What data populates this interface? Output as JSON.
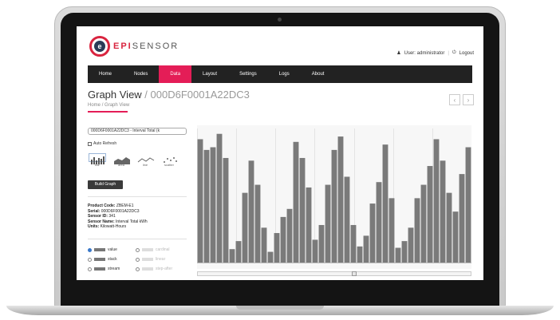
{
  "brand": {
    "name_accent": "EPI",
    "name_rest": "SENSOR",
    "mark": "e",
    "accent_color": "#e41d57"
  },
  "user": {
    "icon": "user-icon",
    "label": "User: administrator",
    "logout_icon": "power-icon",
    "logout": "Logout"
  },
  "nav": {
    "items": [
      {
        "label": "Home"
      },
      {
        "label": "Nodes"
      },
      {
        "label": "Data",
        "active": true
      },
      {
        "label": "Layout"
      },
      {
        "label": "Settings"
      },
      {
        "label": "Logs"
      },
      {
        "label": "About"
      }
    ]
  },
  "page": {
    "title": "Graph View",
    "subtitle": "000D6F0001A22DC3",
    "breadcrumb": {
      "home": "Home",
      "current": "Graph View"
    },
    "prev": "‹",
    "next": "›"
  },
  "panel": {
    "series_value": "000D6F0001A22DC3 - Interval Total (k",
    "auto_refresh": "Auto Refresh",
    "chart_types": [
      {
        "label": "bar",
        "active": true
      },
      {
        "label": "area"
      },
      {
        "label": "line"
      },
      {
        "label": "scatter"
      }
    ],
    "build_button": "Build Graph",
    "meta": [
      {
        "key": "Product Code:",
        "value": "ZBEM-E1"
      },
      {
        "key": "Serial:",
        "value": "000D6F0001A22DC3"
      },
      {
        "key": "Sensor ID:",
        "value": "341"
      },
      {
        "key": "Sensor Name:",
        "value": "Interval Total kWh"
      },
      {
        "key": "Units:",
        "value": "Kilowatt-Hours"
      }
    ],
    "modes": [
      {
        "label": "value",
        "checked": true
      },
      {
        "label": "cardinal",
        "disabled": true
      },
      {
        "label": "stack"
      },
      {
        "label": "linear",
        "disabled": true
      },
      {
        "label": "stream"
      },
      {
        "label": "step-after",
        "disabled": true
      }
    ]
  },
  "chart_data": {
    "type": "bar",
    "values": [
      92,
      84,
      86,
      96,
      78,
      10,
      16,
      52,
      76,
      58,
      26,
      8,
      22,
      34,
      40,
      90,
      78,
      56,
      17,
      28,
      58,
      84,
      94,
      64,
      28,
      12,
      20,
      44,
      60,
      88,
      48,
      11,
      16,
      26,
      48,
      58,
      72,
      92,
      76,
      52,
      38,
      66,
      86
    ],
    "bar_color": "#7a7a7a",
    "grid": true,
    "ylim": [
      0,
      100
    ]
  }
}
